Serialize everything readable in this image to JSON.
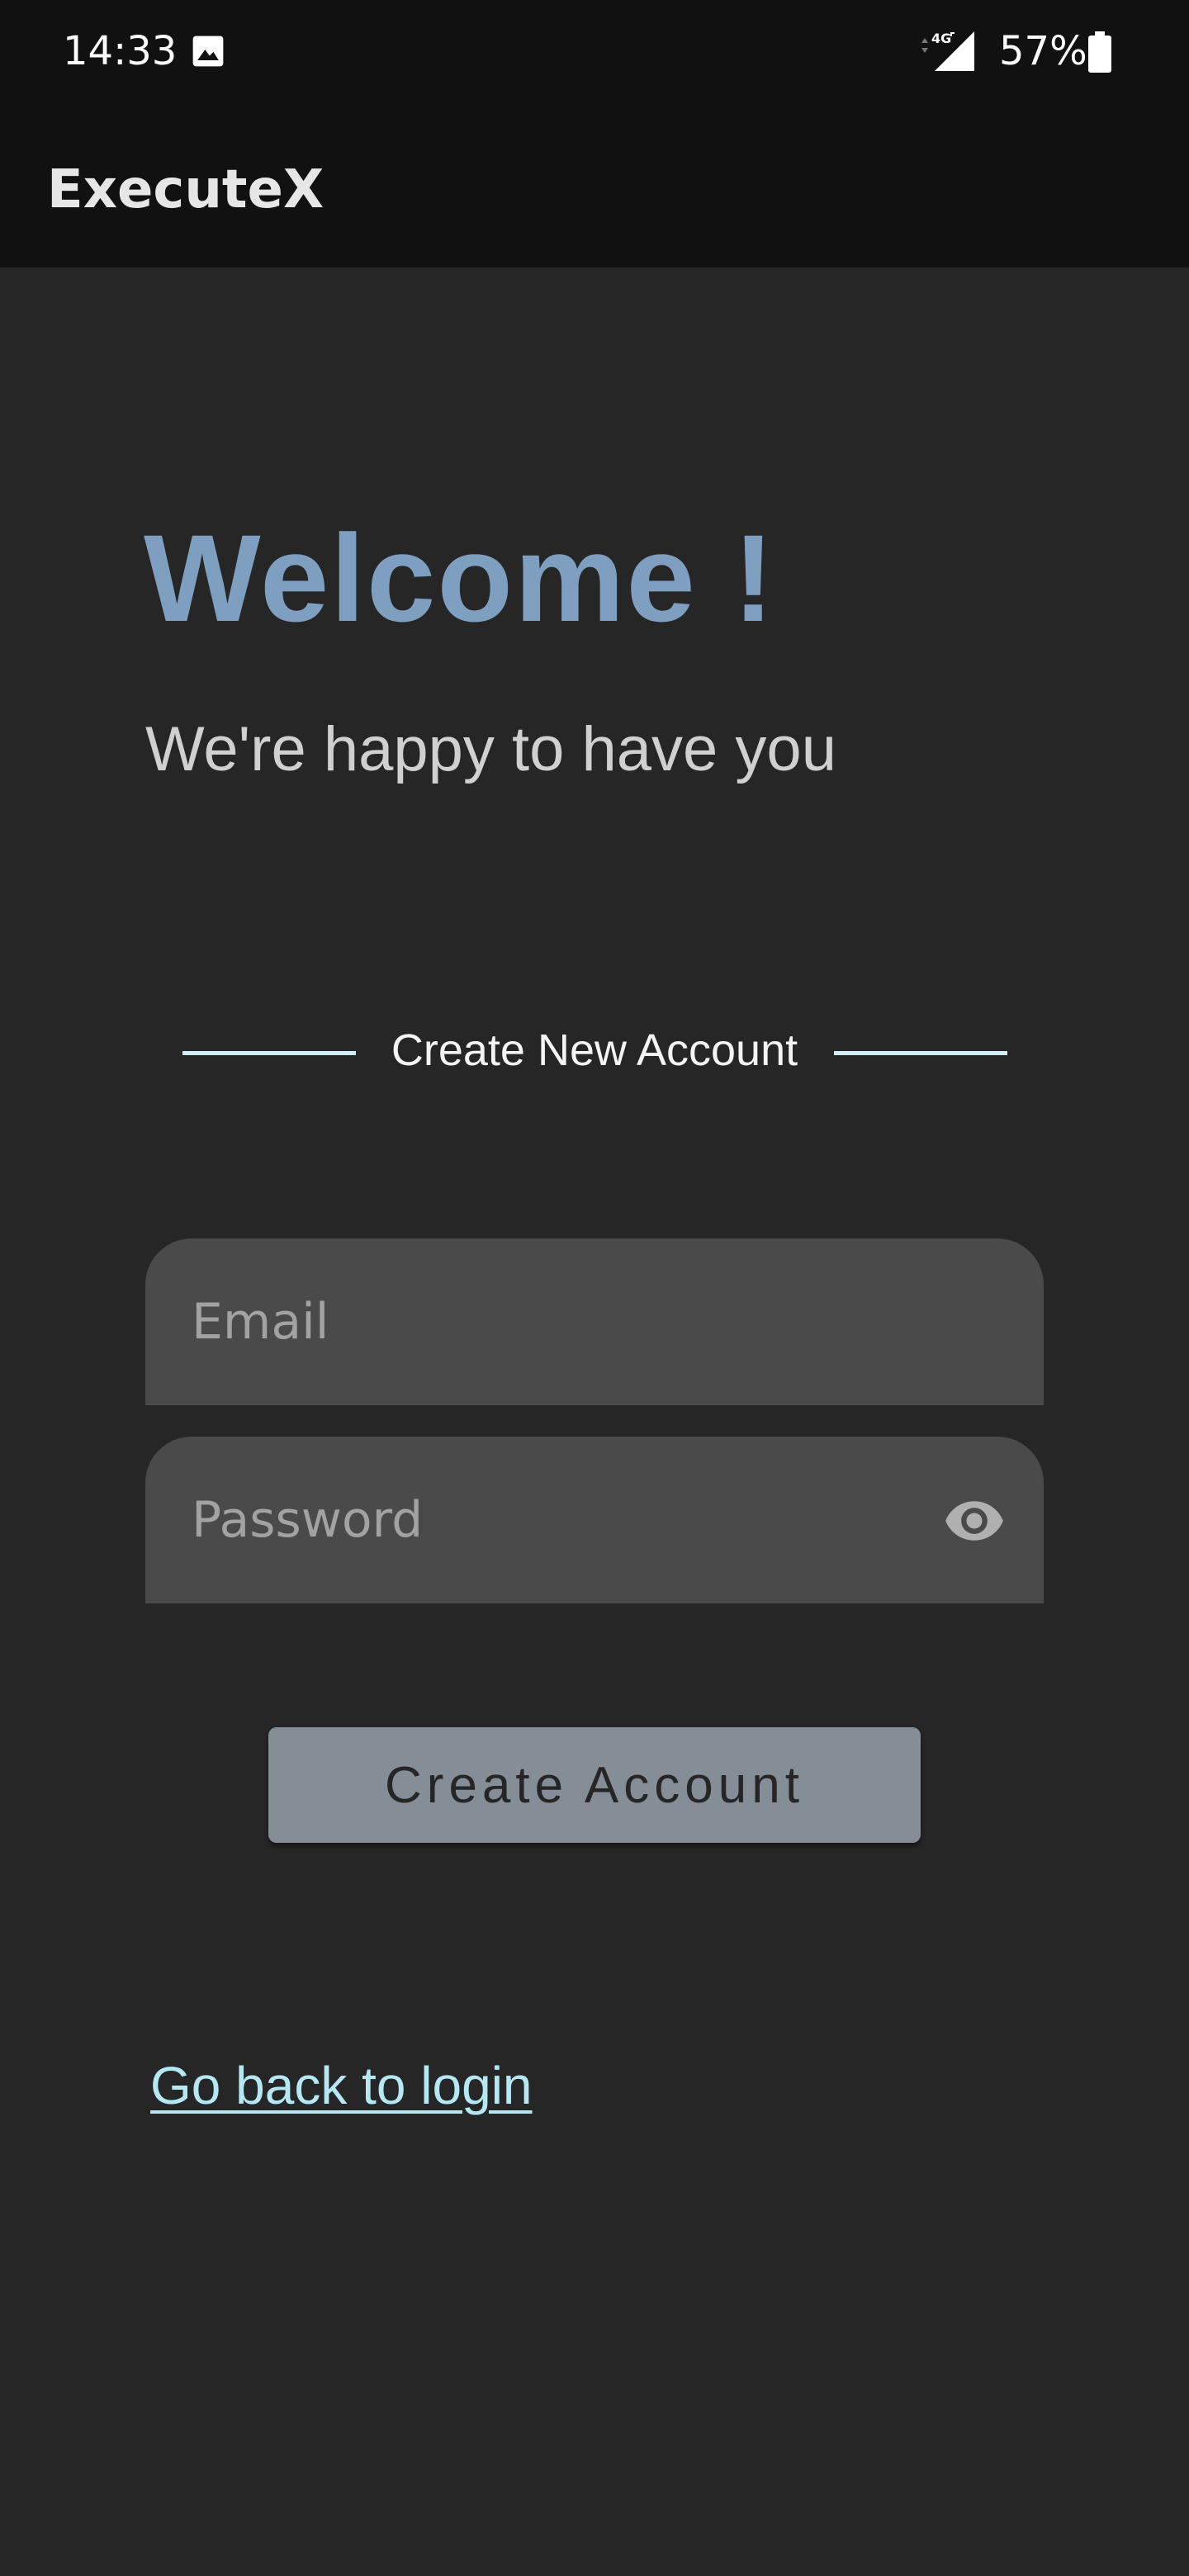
{
  "status_bar": {
    "time": "14:33",
    "battery": "57%",
    "icons": [
      "gallery-icon",
      "network-4g-signal-icon",
      "battery-icon"
    ]
  },
  "app_bar": {
    "title": "ExecuteX"
  },
  "welcome": {
    "title": "Welcome !",
    "subtitle": "We're happy to have you"
  },
  "section": {
    "label": "Create New Account"
  },
  "form": {
    "email": {
      "placeholder": "Email",
      "value": ""
    },
    "password": {
      "placeholder": "Password",
      "value": ""
    },
    "submit_label": "Create Account"
  },
  "links": {
    "back_to_login": "Go back to login"
  },
  "colors": {
    "background": "#262626",
    "bar": "#111111",
    "accent": "#7f9fc0",
    "link": "#b5e8f3",
    "button": "#858d97",
    "field": "#4a4a4a"
  }
}
